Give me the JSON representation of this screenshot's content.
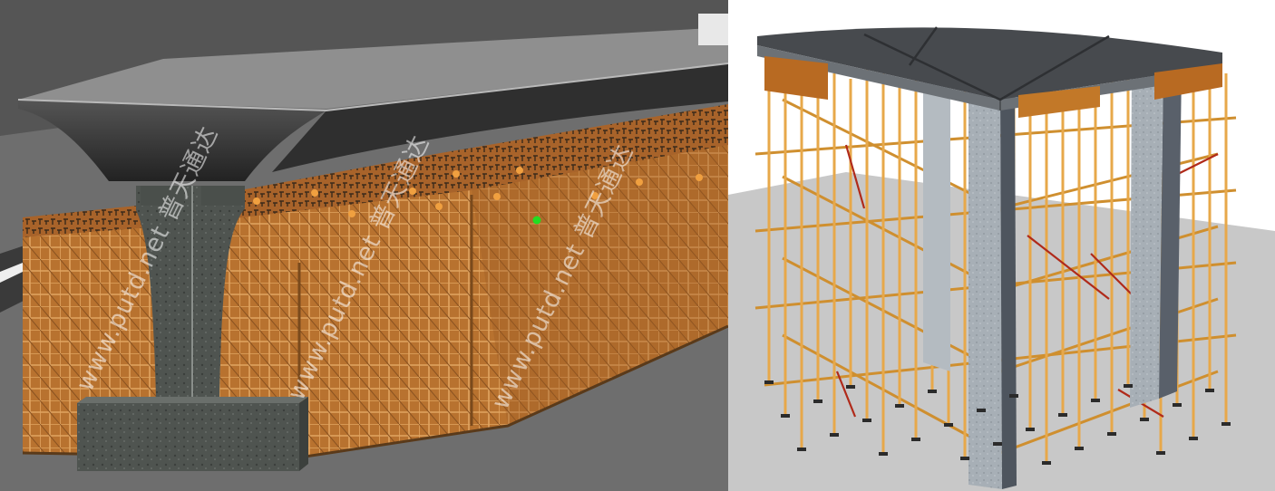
{
  "scenes": [
    {
      "subject": "bridge-pier-scaffold-render",
      "palette": {
        "ground": "#6f6f6f",
        "deck": "#3a3a3a",
        "scaffold": "#c8823a",
        "pier": "#4a4a4a"
      }
    },
    {
      "subject": "column-beam-scaffold-render",
      "palette": {
        "floor": "#c9c9c9",
        "slab": "#4a4d50",
        "tube": "#e0a13c",
        "column": "#9aa3aa"
      }
    }
  ],
  "watermark": {
    "text": "www.putd.net 普天通达"
  }
}
